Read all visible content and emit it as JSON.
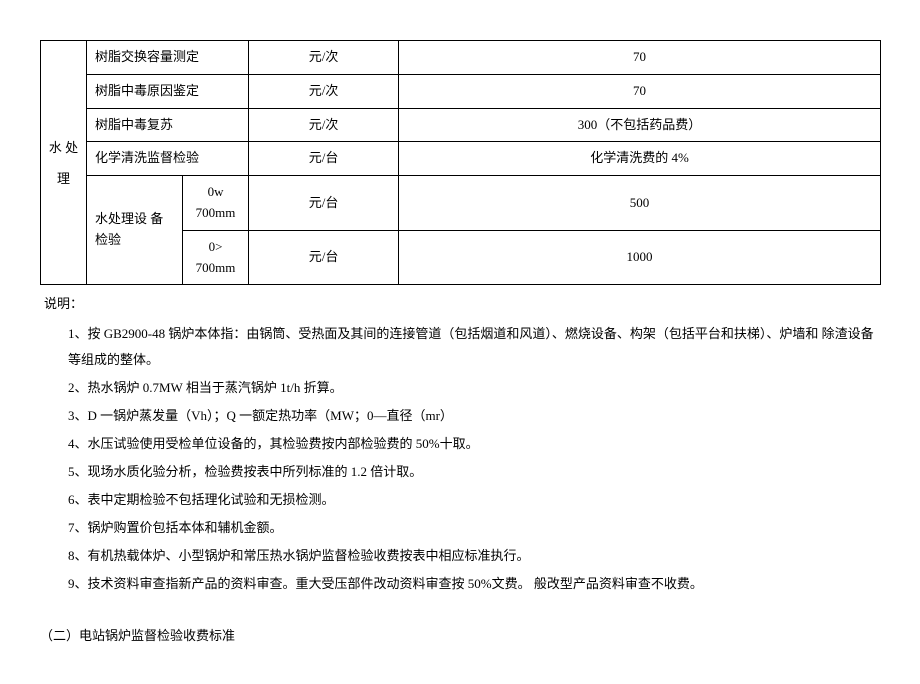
{
  "table": {
    "category": "水 处 理",
    "rows": [
      {
        "item": "树脂交换容量测定",
        "unit": "元/次",
        "value": "70"
      },
      {
        "item": "树脂中毒原因鉴定",
        "unit": "元/次",
        "value": "70"
      },
      {
        "item": "树脂中毒复苏",
        "unit": "元/次",
        "value": "300（不包括药品费）"
      },
      {
        "item": "化学清洗监督检验",
        "unit": "元/台",
        "value": "化学清洗费的 4%"
      }
    ],
    "equip": {
      "label": "水处理设 备检验",
      "sub": [
        {
          "spec": "0w 700mm",
          "unit": "元/台",
          "value": "500"
        },
        {
          "spec": "0> 700mm",
          "unit": "元/台",
          "value": "1000"
        }
      ]
    }
  },
  "notes": {
    "label": "说明：",
    "items": [
      "1、按 GB2900-48 锅炉本体指：由锅筒、受热面及其间的连接管道（包括烟道和风道）、燃烧设备、构架（包括平台和扶梯）、炉墙和 除渣设备等组成的整体。",
      "2、热水锅炉 0.7MW 相当于蒸汽锅炉 1t/h 折算。",
      "3、D 一锅炉蒸发量（Vh）；Q 一额定热功率（MW；0—直径（mr）",
      "4、水压试验使用受检单位设备的，其检验费按内部检验费的 50%十取。",
      "5、现场水质化验分析，检验费按表中所列标准的 1.2 倍计取。",
      "6、表中定期检验不包括理化试验和无损检测。",
      "7、锅炉购置价包括本体和辅机金额。",
      "8、有机热载体炉、小型锅炉和常压热水锅炉监督检验收费按表中相应标准执行。",
      "9、技术资料审查指新产品的资料审查。重大受压部件改动资料审查按 50%文费。 般改型产品资料审查不收费。"
    ]
  },
  "subheader": "（二）电站锅炉监督检验收费标准"
}
